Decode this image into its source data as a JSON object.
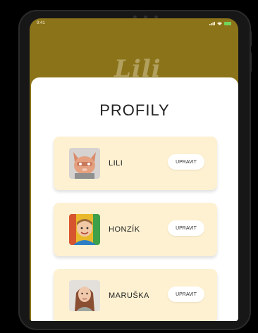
{
  "status_bar": {
    "time": "9:41"
  },
  "background": {
    "logo_text": "Lili"
  },
  "sheet": {
    "title": "PROFILY"
  },
  "profiles": [
    {
      "name": "LILI",
      "edit_label": "UPRAVIT",
      "avatar": "cat-avatar"
    },
    {
      "name": "HONZÍK",
      "edit_label": "UPRAVIT",
      "avatar": "boy-photo"
    },
    {
      "name": "MARUŠKA",
      "edit_label": "UPRAVIT",
      "avatar": "girl-photo"
    }
  ],
  "colors": {
    "header_bg": "#8b7319",
    "card_bg": "#fdf1d1",
    "sheet_bg": "#ffffff"
  }
}
